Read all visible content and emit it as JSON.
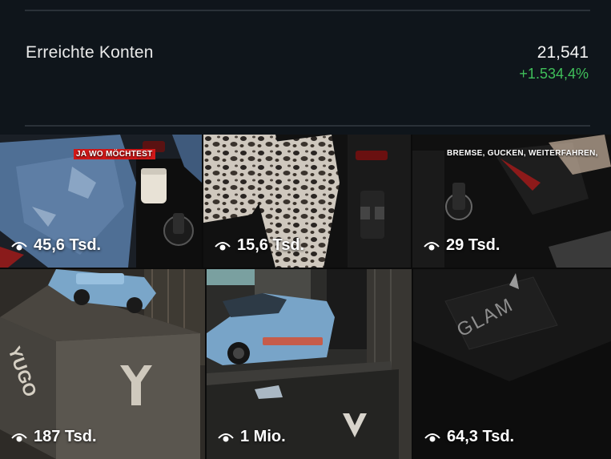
{
  "stats": {
    "label": "Erreichte Konten",
    "value": "21,541",
    "change": "+1.534,4%",
    "change_color": "#3fbf5a"
  },
  "tiles": [
    {
      "views": "45,6 Tsd.",
      "caption": "JA WO MÖCHTEST"
    },
    {
      "views": "15,6 Tsd."
    },
    {
      "views": "29 Tsd.",
      "caption": "BREMSE, GUCKEN, WEITERFAHREN,"
    },
    {
      "views": "187 Tsd.",
      "brand": "YUGO"
    },
    {
      "views": "1 Mio."
    },
    {
      "views": "64,3 Tsd.",
      "brand": "GLAM"
    }
  ],
  "icons": {
    "views": "eye-icon"
  }
}
